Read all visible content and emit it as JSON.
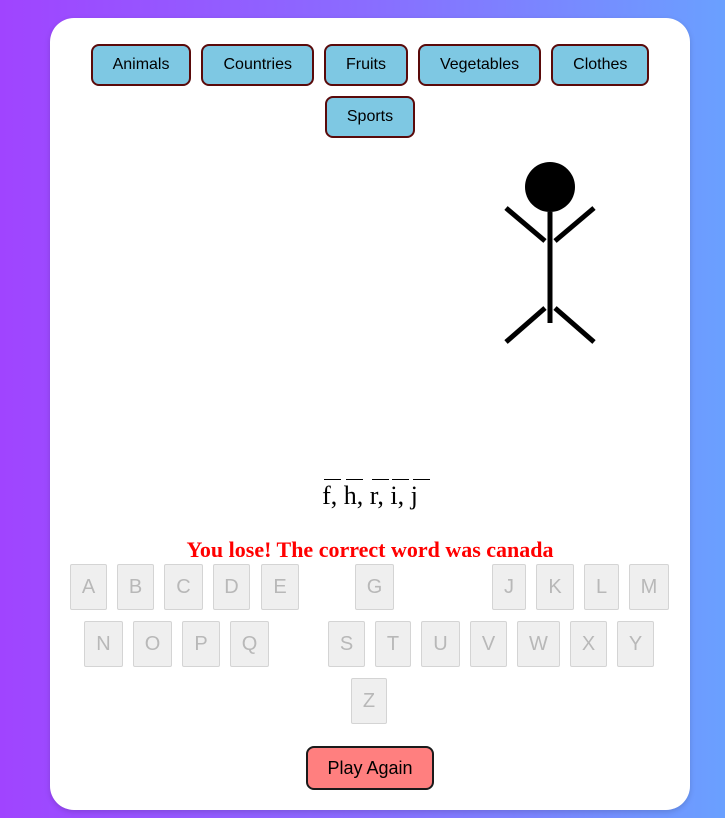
{
  "categories": [
    "Animals",
    "Countries",
    "Fruits",
    "Vegetables",
    "Clothes",
    "Sports"
  ],
  "guessed_letters": [
    "f",
    "h",
    "r",
    "i",
    "j"
  ],
  "word_separator": ",",
  "message": "You lose! The correct word was canada",
  "keys": {
    "row1": [
      "A",
      "B",
      "C",
      "D",
      "E",
      "G",
      "J",
      "K",
      "L",
      "M"
    ],
    "row2": [
      "N",
      "O",
      "P",
      "Q",
      "S",
      "T",
      "U",
      "V",
      "W",
      "X",
      "Y"
    ],
    "row3": [
      "Z"
    ]
  },
  "play_again_label": "Play Again",
  "colors": {
    "category_button": "#7ec8e3",
    "message": "#ff0000",
    "play_again": "#ff7f7f"
  }
}
